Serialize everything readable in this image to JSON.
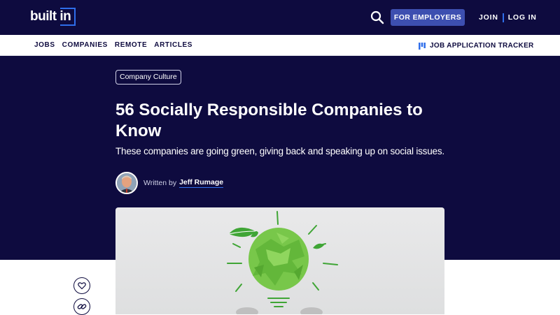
{
  "header": {
    "logo_text": "built in",
    "employers_label": "FOR EMPLOYERS",
    "join_label": "JOIN",
    "login_label": "LOG IN"
  },
  "nav": {
    "items": [
      {
        "label": "JOBS"
      },
      {
        "label": "COMPANIES"
      },
      {
        "label": "REMOTE"
      },
      {
        "label": "ARTICLES"
      }
    ],
    "tracker_label": "JOB APPLICATION TRACKER"
  },
  "article": {
    "tag": "Company Culture",
    "title": "56 Socially Responsible Companies to Know",
    "subtitle": "These companies are going green, giving back and speaking up on social issues.",
    "written_by": "Written by",
    "author": "Jeff Rumage"
  },
  "colors": {
    "brand_navy": "#0e0b3f",
    "accent_blue": "#2f6eea",
    "button_blue": "#3d4fb0"
  },
  "icons": {
    "search": "search-icon",
    "tracker": "tracker-icon",
    "like": "heart-icon",
    "link": "link-icon"
  }
}
